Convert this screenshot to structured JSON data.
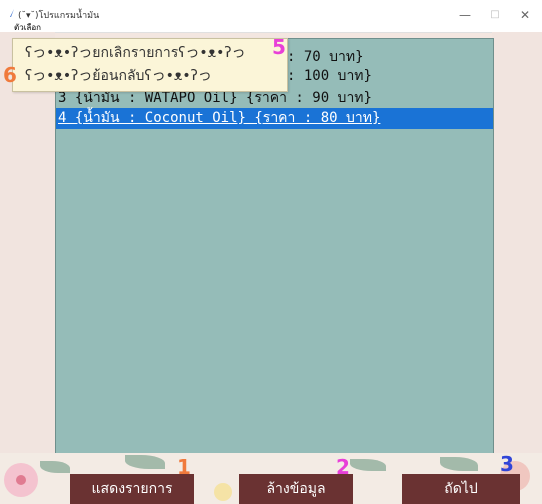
{
  "window": {
    "title": "(˘▾˘)โปรแกรมน้ำมัน",
    "menu_label": "ตัวเลือก",
    "minimize": "—",
    "maximize": "□",
    "close": "✕"
  },
  "list": {
    "items": [
      "1 {น้ำมัน : Olive Oil} {ราคา : 70 บาท}",
      "2 {น้ำมัน : Argan Oil} {ราคา : 100 บาท}",
      "3 {น้ำมัน : WATAPO Oil} {ราคา : 90 บาท}",
      "4 {น้ำมัน : Coconut Oil} {ราคา : 80 บาท}"
    ],
    "selected_index": 3
  },
  "context_menu": {
    "items": [
      "ʕっ•ᴥ•ʔっยกเลิกรายการʕっ•ᴥ•ʔっ",
      "ʕっ•ᴥ•ʔっย้อนกลับʕっ•ᴥ•ʔっ"
    ]
  },
  "markers": {
    "one": "1",
    "two": "2",
    "three": "3",
    "five": "5",
    "six": "6"
  },
  "buttons": {
    "show_list": "แสดงรายการ",
    "clear": "ล้างข้อมูล",
    "next": "ถัดไป"
  },
  "colors": {
    "list_bg": "#95bcb8",
    "selected_bg": "#1a73d6",
    "button_bg": "#6a3232",
    "marker_orange": "#f07a3c",
    "marker_magenta": "#e83fd8",
    "marker_blue": "#3145d8"
  }
}
